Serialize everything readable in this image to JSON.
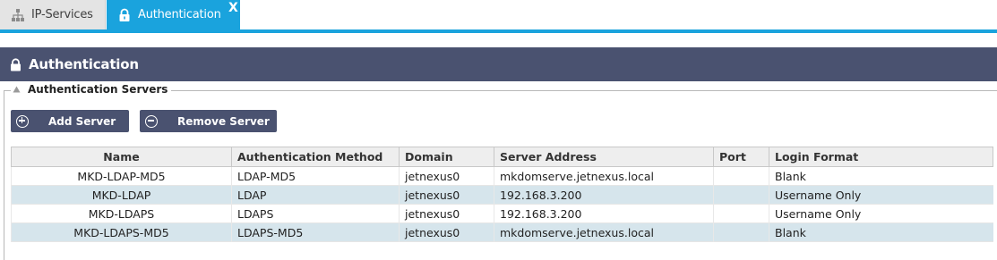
{
  "tabs": [
    {
      "label": "IP-Services",
      "icon": "network-icon",
      "active": false
    },
    {
      "label": "Authentication",
      "icon": "lock-icon",
      "active": true,
      "close_label": "X"
    }
  ],
  "section": {
    "title": "Authentication",
    "icon": "lock-icon"
  },
  "group": {
    "title": "Authentication Servers",
    "icon": "collapse-triangle-icon"
  },
  "buttons": {
    "add": "Add Server",
    "remove": "Remove Server"
  },
  "table": {
    "columns": [
      "Name",
      "Authentication Method",
      "Domain",
      "Server Address",
      "Port",
      "Login Format"
    ],
    "rows": [
      {
        "name": "MKD-LDAP-MD5",
        "method": "LDAP-MD5",
        "domain": "jetnexus0",
        "address": "mkdomserve.jetnexus.local",
        "port": "",
        "format": "Blank"
      },
      {
        "name": "MKD-LDAP",
        "method": "LDAP",
        "domain": "jetnexus0",
        "address": "192.168.3.200",
        "port": "",
        "format": "Username Only"
      },
      {
        "name": "MKD-LDAPS",
        "method": "LDAPS",
        "domain": "jetnexus0",
        "address": "192.168.3.200",
        "port": "",
        "format": "Username Only"
      },
      {
        "name": "MKD-LDAPS-MD5",
        "method": "LDAPS-MD5",
        "domain": "jetnexus0",
        "address": "mkdomserve.jetnexus.local",
        "port": "",
        "format": "Blank"
      }
    ]
  },
  "colors": {
    "accent": "#1aa3dd",
    "header": "#4a5270",
    "alt_row": "#d6e5ec"
  }
}
